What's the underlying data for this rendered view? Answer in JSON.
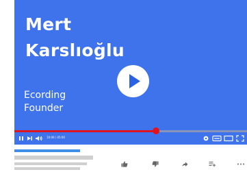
{
  "video": {
    "title_line_1": "Mert",
    "title_line_2": "Karslıoğlu",
    "subtitle_line_1": "Ecording",
    "subtitle_line_2": "Founder",
    "background_color": "#3f73ec",
    "progress_fraction": 0.61,
    "time_readout": "10:00 / 45:00",
    "played_color": "#e0141e",
    "buffer_color": "#8a93b8"
  },
  "controls": {
    "left": [
      "pause-icon",
      "skip-next-icon",
      "volume-icon"
    ],
    "right": [
      "gear-icon",
      "subtitles-icon",
      "theater-icon",
      "fullscreen-icon"
    ]
  },
  "below": {
    "accent_color": "#3f8fe8",
    "placeholder_color": "#cfcfcf",
    "actions": [
      "like-icon",
      "dislike-icon",
      "share-icon",
      "add-to-playlist-icon",
      "more-icon"
    ]
  }
}
